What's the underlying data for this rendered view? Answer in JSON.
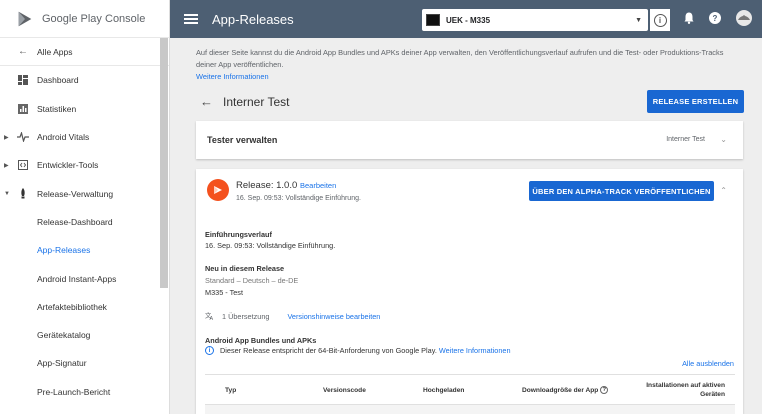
{
  "brand": {
    "name_google": "Google Play",
    "name_console": "Console"
  },
  "sidebar": {
    "items": [
      {
        "label": "Alle Apps"
      },
      {
        "label": "Dashboard"
      },
      {
        "label": "Statistiken"
      },
      {
        "label": "Android Vitals"
      },
      {
        "label": "Entwickler-Tools"
      },
      {
        "label": "Release-Verwaltung"
      },
      {
        "label": "Release-Dashboard"
      },
      {
        "label": "App-Releases"
      },
      {
        "label": "Android Instant-Apps"
      },
      {
        "label": "Artefaktebibliothek"
      },
      {
        "label": "Gerätekatalog"
      },
      {
        "label": "App-Signatur"
      },
      {
        "label": "Pre-Launch-Bericht"
      }
    ]
  },
  "topbar": {
    "title": "App-Releases",
    "app_name": "UEK - M335"
  },
  "intro": {
    "text": "Auf dieser Seite kannst du die Android App Bundles und APKs deiner App verwalten, den Veröffentlichungsverlauf aufrufen und die Test- oder Produktions-Tracks deiner App veröffentlichen.",
    "link": "Weitere Informationen"
  },
  "page": {
    "title": "Interner Test",
    "create_button": "RELEASE ERSTELLEN"
  },
  "tester": {
    "title": "Tester verwalten",
    "track": "Interner Test"
  },
  "release": {
    "name": "Release: 1.0.0",
    "edit": "Bearbeiten",
    "date": "16. Sep. 09:53: Vollständige Einführung.",
    "alpha_button": "ÜBER DEN ALPHA-TRACK VERÖFFENTLICHEN",
    "history_title": "Einführungsverlauf",
    "history_text": "16. Sep. 09:53: Vollständige Einführung.",
    "new_title": "Neu in diesem Release",
    "new_lang": "Standard – Deutsch – de-DE",
    "new_text": "M335 - Test",
    "translations": "1 Übersetzung",
    "edit_notes": "Versionshinweise bearbeiten",
    "bundles_title": "Android App Bundles und APKs",
    "bundles_info": "Dieser Release entspricht der 64-Bit-Anforderung von Google Play.",
    "bundles_link": "Weitere Informationen",
    "hide_all": "Alle ausblenden"
  },
  "table": {
    "columns": [
      "Typ",
      "Versionscode",
      "Hochgeladen",
      "Downloadgröße der App",
      "Installationen auf aktiven Geräten"
    ]
  }
}
